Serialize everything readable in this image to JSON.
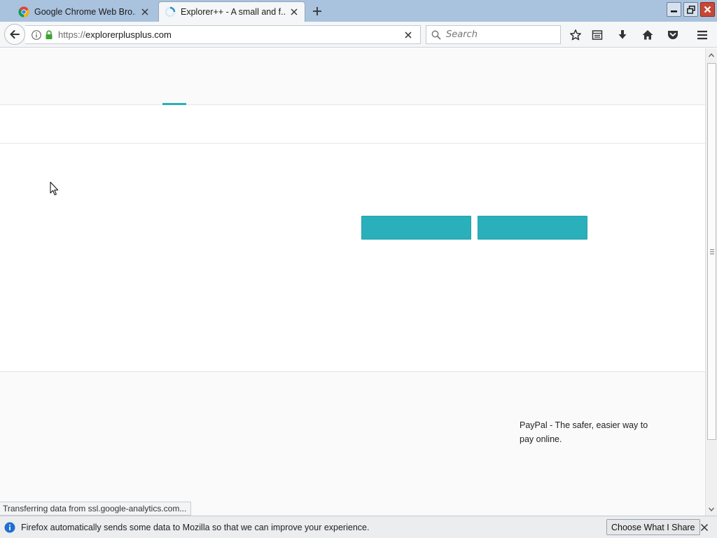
{
  "tabs": [
    {
      "title": "Google Chrome Web Bro...",
      "favicon": "chrome-icon",
      "active": false
    },
    {
      "title": "Explorer++ - A small and f...",
      "favicon": "loading-spinner-icon",
      "active": true
    }
  ],
  "navbar": {
    "url_scheme": "https://",
    "url_host": "explorerplusplus.com",
    "search_placeholder": "Search"
  },
  "page": {
    "footer_text": "PayPal - The safer, easier way to pay online.",
    "accent_color": "#2ab0bb"
  },
  "status": {
    "text": "Transferring data from ssl.google-analytics.com..."
  },
  "notification": {
    "message": "Firefox automatically sends some data to Mozilla so that we can improve your experience.",
    "button_label": "Choose What I Share"
  }
}
